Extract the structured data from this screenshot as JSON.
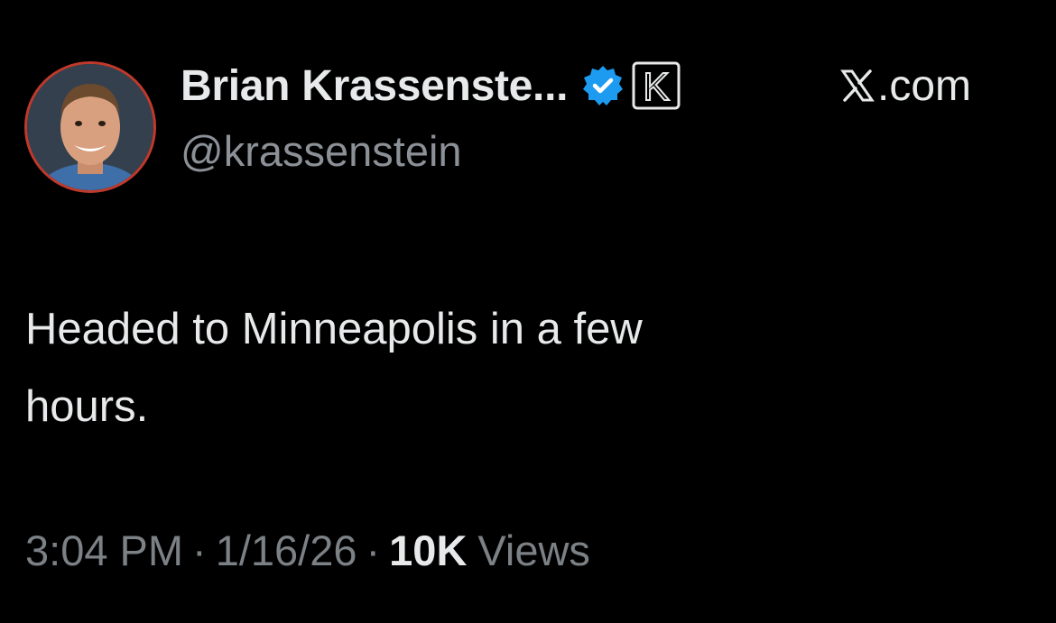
{
  "author": {
    "display_name": "Brian Krassenste...",
    "handle": "@krassenstein",
    "avatar": "profile-photo",
    "verified_icon": "verified-badge-icon",
    "affiliate_badge": "K",
    "avatar_border_color": "#c0392b",
    "verified_color": "#1d9bf0"
  },
  "source": {
    "logo": "x-logo-icon",
    "label": ".com"
  },
  "tweet": {
    "text": "Headed to Minneapolis in a few\nhours."
  },
  "meta": {
    "time": "3:04 PM",
    "separator": "·",
    "date": "1/16/26",
    "views_count": "10K",
    "views_label": "Views"
  },
  "colors": {
    "background": "#000000",
    "primary_text": "#e7e9ea",
    "secondary_text": "#8b9197"
  }
}
